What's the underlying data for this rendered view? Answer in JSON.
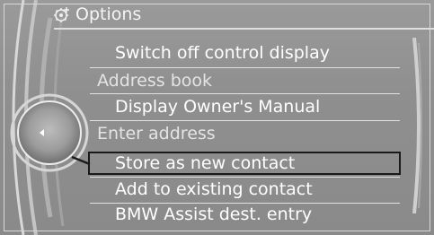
{
  "header": {
    "icon": "options-gear-icon",
    "title": "Options"
  },
  "menu": {
    "items": [
      {
        "label": "Switch off control display",
        "kind": "action"
      },
      {
        "label": "Address book",
        "kind": "section"
      },
      {
        "label": "Display Owner's Manual",
        "kind": "action"
      },
      {
        "label": "Enter address",
        "kind": "section"
      },
      {
        "label": "Store as new contact",
        "kind": "action",
        "selected": true
      },
      {
        "label": "Add to existing contact",
        "kind": "action"
      },
      {
        "label": "BMW Assist dest. entry",
        "kind": "action"
      }
    ]
  },
  "controller": {
    "icon": "controller-left-arrow-icon"
  },
  "colors": {
    "background": "#8f8f8f",
    "text": "#ffffff",
    "section_text": "#e4e4e4",
    "focus_border": "#1a1a1a"
  }
}
